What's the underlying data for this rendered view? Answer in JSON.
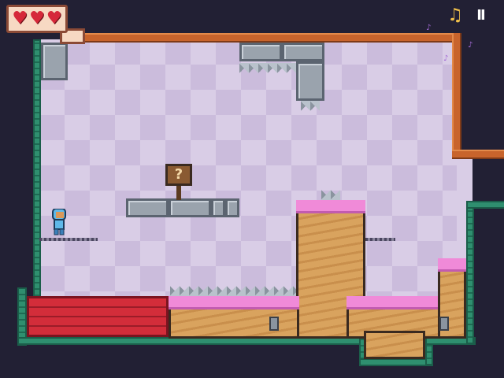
{
  "hud": {
    "hearts": [
      "♥",
      "♥",
      "♥"
    ],
    "music_icon": "♫",
    "pause_icon": "II"
  },
  "world": {
    "sign_text": "?",
    "note_glyph": "♪"
  },
  "colors": {
    "background": "#222034",
    "heart": "#d6283a",
    "goo": "#f08ad8",
    "lava": "#d32d3a",
    "pipe": "#c8642c"
  }
}
